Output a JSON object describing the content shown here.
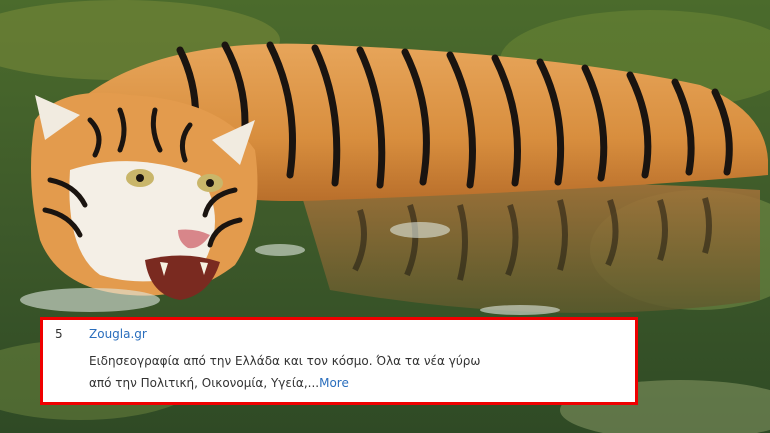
{
  "result": {
    "rank": "5",
    "site": "Zougla.gr",
    "snippet_line1": "Ειδησεογραφία από την Ελλάδα και τον κόσμο. Όλα τα νέα γύρω",
    "snippet_line2": "από την Πολιτική, Οικονομία, Υγεία,...",
    "more_label": "More"
  },
  "colors": {
    "highlight_border": "#ef0000",
    "link": "#2a6ebd",
    "text": "#333333"
  }
}
